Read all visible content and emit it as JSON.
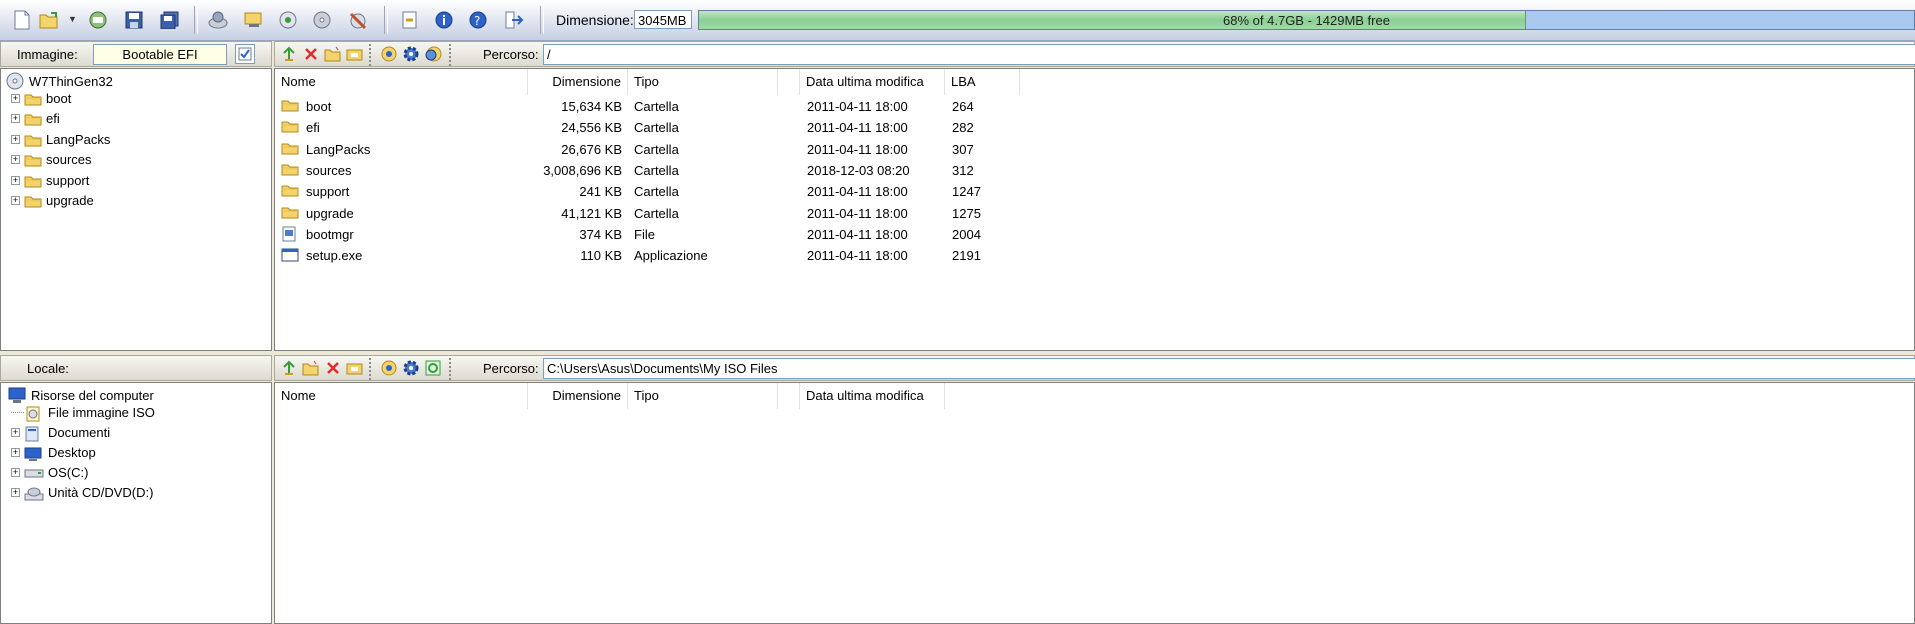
{
  "toolbar": {
    "buttons": [
      "new-icon",
      "open-icon",
      "save-as-icon",
      "save-icon",
      "save-all-icon",
      "burn-icon",
      "mount-icon",
      "extract-icon",
      "convert-icon",
      "wizard-icon",
      "properties-icon",
      "info-icon",
      "help-icon",
      "exit-icon"
    ],
    "size_label": "Dimensione:",
    "size_value": "3045MB",
    "progress_text": "68% of 4.7GB - 1429MB free",
    "progress_fraction": 0.68
  },
  "image_panel": {
    "label": "Immagine:",
    "boot_type": "Bootable EFI",
    "path_label": "Percorso:",
    "path": "/",
    "tree_root": "W7ThinGen32",
    "tree_items": [
      "boot",
      "efi",
      "LangPacks",
      "sources",
      "support",
      "upgrade"
    ],
    "columns": [
      "Nome",
      "Dimensione",
      "Tipo",
      "Data ultima modifica",
      "LBA"
    ],
    "rows": [
      {
        "name": "boot",
        "size": "15,634 KB",
        "type": "Cartella",
        "date": "2011-04-11 18:00",
        "lba": "264",
        "icon": "folder-icon"
      },
      {
        "name": "efi",
        "size": "24,556 KB",
        "type": "Cartella",
        "date": "2011-04-11 18:00",
        "lba": "282",
        "icon": "folder-icon"
      },
      {
        "name": "LangPacks",
        "size": "26,676 KB",
        "type": "Cartella",
        "date": "2011-04-11 18:00",
        "lba": "307",
        "icon": "folder-icon"
      },
      {
        "name": "sources",
        "size": "3,008,696 KB",
        "type": "Cartella",
        "date": "2018-12-03 08:20",
        "lba": "312",
        "icon": "folder-icon"
      },
      {
        "name": "support",
        "size": "241 KB",
        "type": "Cartella",
        "date": "2011-04-11 18:00",
        "lba": "1247",
        "icon": "folder-icon"
      },
      {
        "name": "upgrade",
        "size": "41,121 KB",
        "type": "Cartella",
        "date": "2011-04-11 18:00",
        "lba": "1275",
        "icon": "folder-icon"
      },
      {
        "name": "bootmgr",
        "size": "374 KB",
        "type": "File",
        "date": "2011-04-11 18:00",
        "lba": "2004",
        "icon": "file-icon"
      },
      {
        "name": "setup.exe",
        "size": "110 KB",
        "type": "Applicazione",
        "date": "2011-04-11 18:00",
        "lba": "2191",
        "icon": "app-icon"
      }
    ]
  },
  "local_panel": {
    "label": "Locale:",
    "path_label": "Percorso:",
    "path": "C:\\Users\\Asus\\Documents\\My ISO Files",
    "tree_root": "Risorse del computer",
    "tree_items": [
      "File immagine ISO",
      "Documenti",
      "Desktop",
      "OS(C:)",
      "Unità CD/DVD(D:)"
    ],
    "columns": [
      "Nome",
      "Dimensione",
      "Tipo",
      "Data ultima modifica"
    ]
  },
  "colors": {
    "accent": "#3a6ea5",
    "progress_used": "#8ccf94",
    "progress_free": "#a8c8ef"
  }
}
